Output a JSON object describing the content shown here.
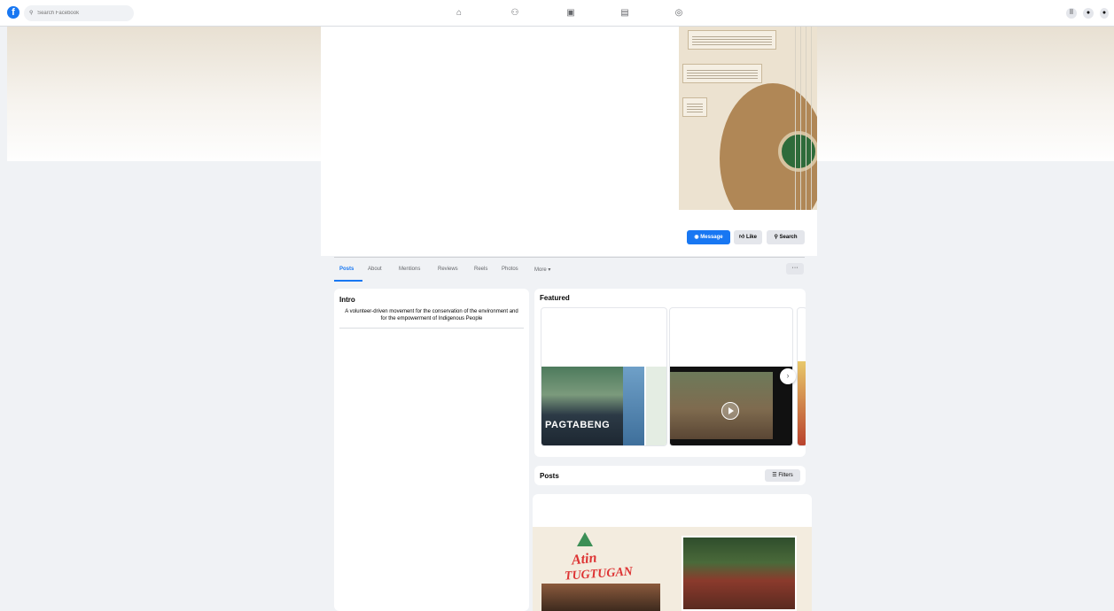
{
  "topbar": {
    "logo_letter": "f",
    "search_placeholder": "Search Facebook",
    "nav_icons": [
      "home-icon",
      "friends-icon",
      "watch-icon",
      "marketplace-icon",
      "groups-icon"
    ],
    "right_icons": [
      "menu-grid-icon",
      "messenger-icon",
      "notifications-icon"
    ]
  },
  "profile": {
    "actions": {
      "message": "Message",
      "like": "Like",
      "search": "Search"
    }
  },
  "tabs": {
    "items": [
      "Posts",
      "About",
      "Mentions",
      "Reviews",
      "Reels",
      "Photos",
      "More ▾"
    ],
    "active": "Posts",
    "more_dots": "···"
  },
  "intro": {
    "title": "Intro",
    "bio": "A volunteer-driven movement for the conservation of the environment and for the empowerment of Indigenous People"
  },
  "featured": {
    "title": "Featured",
    "item_text": "PAGTABENG",
    "next_icon": "›"
  },
  "posts": {
    "title": "Posts",
    "filters_label": "Filters",
    "post_banner_line1": "Atin",
    "post_banner_line2": "TUGTUGAN"
  },
  "colors": {
    "accent": "#1877f2",
    "background": "#f0f2f5"
  }
}
